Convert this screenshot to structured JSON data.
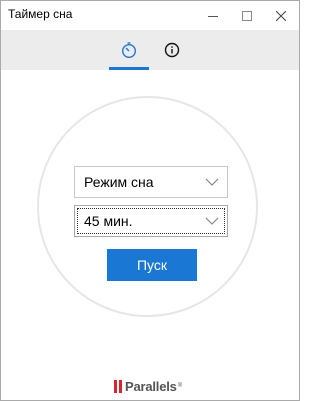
{
  "window": {
    "title": "Таймер сна"
  },
  "tabs": [
    {
      "icon": "timer-icon",
      "active": true
    },
    {
      "icon": "info-icon",
      "active": false
    }
  ],
  "colors": {
    "accent": "#1a78d4",
    "tabbar_bg": "#ececec",
    "logo_red": "#d9262e"
  },
  "form": {
    "mode_select": {
      "value": "Режим сна"
    },
    "time_select": {
      "value": "45 мин."
    },
    "start_button": "Пуск"
  },
  "footer": {
    "logo_text": "Parallels",
    "logo_mark": "®"
  }
}
